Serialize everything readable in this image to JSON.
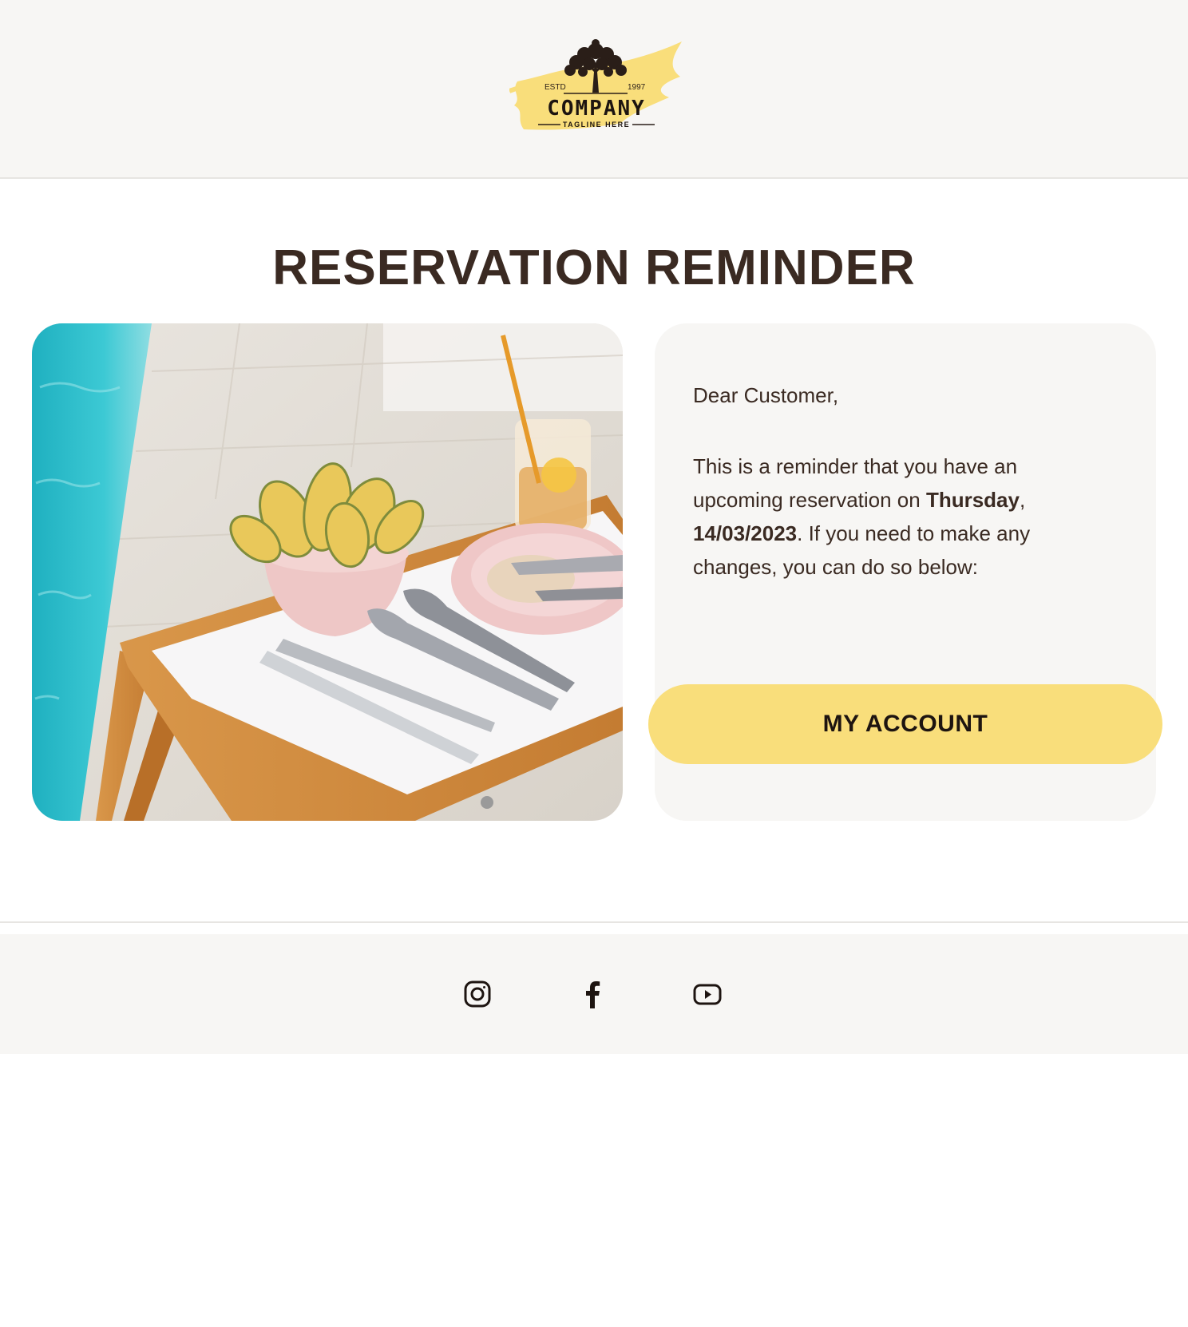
{
  "header": {
    "logo": {
      "estd_label": "ESTD",
      "year": "1997",
      "company_name": "COMPANY",
      "tagline": "TAGLINE HERE",
      "brand_color": "#f9de7b"
    }
  },
  "main": {
    "title": "RESERVATION REMINDER",
    "greeting": "Dear Customer,",
    "message": {
      "part1": "This is a reminder that you have an upcoming reservation on ",
      "day": "Thursday",
      "part2": ", ",
      "date": "14/03/2023",
      "part3": ". If you need to make any changes, you can do so below:"
    },
    "button_label": "MY ACCOUNT",
    "button_color": "#f9de7b"
  },
  "footer": {
    "social": [
      "instagram-icon",
      "facebook-icon",
      "youtube-icon"
    ]
  }
}
